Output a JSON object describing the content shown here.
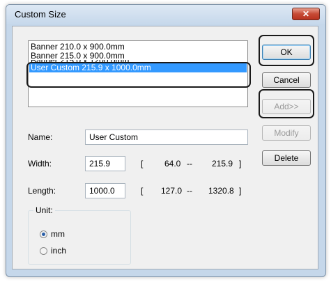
{
  "window": {
    "title": "Custom Size",
    "close_glyph": "✕"
  },
  "list": {
    "items": [
      "Banner 210.0 x 900.0mm",
      "Banner 215.0 x 900.0mm",
      "Banner 215.0 x 1200.0mm",
      "User Custom 215.9 x 1000.0mm"
    ],
    "selected_index": 3
  },
  "buttons": {
    "ok": "OK",
    "cancel": "Cancel",
    "add": "Add>>",
    "modify": "Modify",
    "delete": "Delete"
  },
  "name": {
    "label": "Name:",
    "value": "User Custom"
  },
  "width": {
    "label": "Width:",
    "value": "215.9",
    "bracket_open": "[",
    "min": "64.0",
    "dash": "--",
    "max": "215.9",
    "bracket_close": "]"
  },
  "length": {
    "label": "Length:",
    "value": "1000.0",
    "bracket_open": "[",
    "min": "127.0",
    "dash": "--",
    "max": "1320.8",
    "bracket_close": "]"
  },
  "unit": {
    "title": "Unit:",
    "options": [
      "mm",
      "inch"
    ],
    "selected": "mm"
  }
}
